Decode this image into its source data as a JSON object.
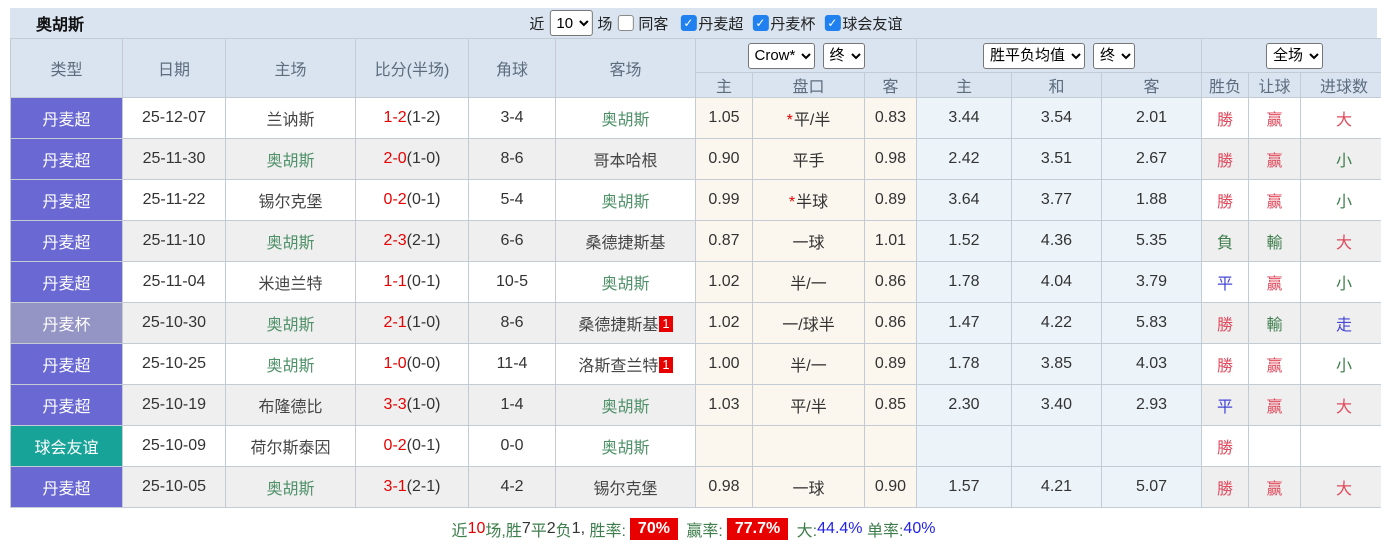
{
  "colors": {
    "header-bg": "#d9e4f0",
    "border": "#c3cbd5",
    "stripe": "#efefef",
    "odds-bg": "#fcf7ee",
    "mean-bg": "#ecf4fa",
    "league-super": "#6a68d2",
    "league-cup": "#9595c5",
    "league-friendly": "#17a398",
    "self-green": "#4f9168",
    "score-red": "#e80000",
    "result-red": "#e04a5c",
    "result-green": "#3e7e4c",
    "result-blue": "#4646d8",
    "footer-blue": "#2222e6",
    "badge-red": "#e80000",
    "checkbox-blue": "#2080f0"
  },
  "header": {
    "title": "奥胡斯",
    "recent_label": "近",
    "recent_value": "10",
    "matches_label": "场",
    "same_venue_label": "同客",
    "same_venue_checked": false,
    "filters": [
      {
        "label": "丹麦超",
        "checked": true
      },
      {
        "label": "丹麦杯",
        "checked": true
      },
      {
        "label": "球会友谊",
        "checked": true
      }
    ]
  },
  "table": {
    "main_headers": [
      "类型",
      "日期",
      "主场",
      "比分(半场)",
      "角球",
      "客场"
    ],
    "selects": {
      "odds_company": "Crow*",
      "odds_time": "终",
      "mean_type": "胜平负均值",
      "mean_time": "终",
      "scope": "全场"
    },
    "sub_headers": [
      "主",
      "盘口",
      "客",
      "主",
      "和",
      "客",
      "胜负",
      "让球",
      "进球数"
    ],
    "result_colors": {
      "勝": "red",
      "負": "green",
      "平": "blue",
      "赢": "red",
      "輸": "green",
      "走": "blue",
      "大": "red",
      "小": "green"
    },
    "rows": [
      {
        "type": "丹麦超",
        "league": "super",
        "date": "25-12-07",
        "home": "兰讷斯",
        "home_self": false,
        "score": "1-2",
        "half": "(1-2)",
        "corner": "3-4",
        "away": "奥胡斯",
        "away_self": true,
        "away_badge": "",
        "odds_home": "1.05",
        "handicap": "平/半",
        "handicap_star": true,
        "odds_away": "0.83",
        "mean_home": "3.44",
        "mean_draw": "3.54",
        "mean_away": "2.01",
        "result": "勝",
        "handicap_result": "赢",
        "goals_result": "大"
      },
      {
        "type": "丹麦超",
        "league": "super",
        "date": "25-11-30",
        "home": "奥胡斯",
        "home_self": true,
        "score": "2-0",
        "half": "(1-0)",
        "corner": "8-6",
        "away": "哥本哈根",
        "away_self": false,
        "away_badge": "",
        "odds_home": "0.90",
        "handicap": "平手",
        "handicap_star": false,
        "odds_away": "0.98",
        "mean_home": "2.42",
        "mean_draw": "3.51",
        "mean_away": "2.67",
        "result": "勝",
        "handicap_result": "赢",
        "goals_result": "小"
      },
      {
        "type": "丹麦超",
        "league": "super",
        "date": "25-11-22",
        "home": "锡尔克堡",
        "home_self": false,
        "score": "0-2",
        "half": "(0-1)",
        "corner": "5-4",
        "away": "奥胡斯",
        "away_self": true,
        "away_badge": "",
        "odds_home": "0.99",
        "handicap": "半球",
        "handicap_star": true,
        "odds_away": "0.89",
        "mean_home": "3.64",
        "mean_draw": "3.77",
        "mean_away": "1.88",
        "result": "勝",
        "handicap_result": "赢",
        "goals_result": "小"
      },
      {
        "type": "丹麦超",
        "league": "super",
        "date": "25-11-10",
        "home": "奥胡斯",
        "home_self": true,
        "score": "2-3",
        "half": "(2-1)",
        "corner": "6-6",
        "away": "桑德捷斯基",
        "away_self": false,
        "away_badge": "",
        "odds_home": "0.87",
        "handicap": "一球",
        "handicap_star": false,
        "odds_away": "1.01",
        "mean_home": "1.52",
        "mean_draw": "4.36",
        "mean_away": "5.35",
        "result": "負",
        "handicap_result": "輸",
        "goals_result": "大"
      },
      {
        "type": "丹麦超",
        "league": "super",
        "date": "25-11-04",
        "home": "米迪兰特",
        "home_self": false,
        "score": "1-1",
        "half": "(0-1)",
        "corner": "10-5",
        "away": "奥胡斯",
        "away_self": true,
        "away_badge": "",
        "odds_home": "1.02",
        "handicap": "半/一",
        "handicap_star": false,
        "odds_away": "0.86",
        "mean_home": "1.78",
        "mean_draw": "4.04",
        "mean_away": "3.79",
        "result": "平",
        "handicap_result": "赢",
        "goals_result": "小"
      },
      {
        "type": "丹麦杯",
        "league": "cup",
        "date": "25-10-30",
        "home": "奥胡斯",
        "home_self": true,
        "score": "2-1",
        "half": "(1-0)",
        "corner": "8-6",
        "away": "桑德捷斯基",
        "away_self": false,
        "away_badge": "1",
        "odds_home": "1.02",
        "handicap": "一/球半",
        "handicap_star": false,
        "odds_away": "0.86",
        "mean_home": "1.47",
        "mean_draw": "4.22",
        "mean_away": "5.83",
        "result": "勝",
        "handicap_result": "輸",
        "goals_result": "走"
      },
      {
        "type": "丹麦超",
        "league": "super",
        "date": "25-10-25",
        "home": "奥胡斯",
        "home_self": true,
        "score": "1-0",
        "half": "(0-0)",
        "corner": "11-4",
        "away": "洛斯查兰特",
        "away_self": false,
        "away_badge": "1",
        "odds_home": "1.00",
        "handicap": "半/一",
        "handicap_star": false,
        "odds_away": "0.89",
        "mean_home": "1.78",
        "mean_draw": "3.85",
        "mean_away": "4.03",
        "result": "勝",
        "handicap_result": "赢",
        "goals_result": "小"
      },
      {
        "type": "丹麦超",
        "league": "super",
        "date": "25-10-19",
        "home": "布隆德比",
        "home_self": false,
        "score": "3-3",
        "half": "(1-0)",
        "corner": "1-4",
        "away": "奥胡斯",
        "away_self": true,
        "away_badge": "",
        "odds_home": "1.03",
        "handicap": "平/半",
        "handicap_star": false,
        "odds_away": "0.85",
        "mean_home": "2.30",
        "mean_draw": "3.40",
        "mean_away": "2.93",
        "result": "平",
        "handicap_result": "赢",
        "goals_result": "大"
      },
      {
        "type": "球会友谊",
        "league": "friendly",
        "date": "25-10-09",
        "home": "荷尔斯泰因",
        "home_self": false,
        "score": "0-2",
        "half": "(0-1)",
        "corner": "0-0",
        "away": "奥胡斯",
        "away_self": true,
        "away_badge": "",
        "odds_home": "",
        "handicap": "",
        "handicap_star": false,
        "odds_away": "",
        "mean_home": "",
        "mean_draw": "",
        "mean_away": "",
        "result": "勝",
        "handicap_result": "",
        "goals_result": ""
      },
      {
        "type": "丹麦超",
        "league": "super",
        "date": "25-10-05",
        "home": "奥胡斯",
        "home_self": true,
        "score": "3-1",
        "half": "(2-1)",
        "corner": "4-2",
        "away": "锡尔克堡",
        "away_self": false,
        "away_badge": "",
        "odds_home": "0.98",
        "handicap": "一球",
        "handicap_star": false,
        "odds_away": "0.90",
        "mean_home": "1.57",
        "mean_draw": "4.21",
        "mean_away": "5.07",
        "result": "勝",
        "handicap_result": "赢",
        "goals_result": "大"
      }
    ]
  },
  "footer": {
    "segments": [
      {
        "text": "近",
        "style": "green"
      },
      {
        "text": "10",
        "style": "red"
      },
      {
        "text": "场,",
        "style": "green"
      },
      {
        "text": "胜",
        "style": "green"
      },
      {
        "text": "7",
        "style": "dark"
      },
      {
        "text": "平",
        "style": "green"
      },
      {
        "text": "2",
        "style": "dark"
      },
      {
        "text": "负",
        "style": "green"
      },
      {
        "text": "1, ",
        "style": "dark"
      },
      {
        "text": "胜率:",
        "style": "green"
      },
      {
        "text": "70%",
        "style": "badge-red"
      },
      {
        "text": " ",
        "style": "dark"
      },
      {
        "text": "赢率:",
        "style": "green"
      },
      {
        "text": "77.7%",
        "style": "badge-red"
      },
      {
        "text": " 大:",
        "style": "green"
      },
      {
        "text": "44.4%",
        "style": "blue"
      },
      {
        "text": " 单率:",
        "style": "green"
      },
      {
        "text": "40%",
        "style": "blue"
      }
    ]
  }
}
